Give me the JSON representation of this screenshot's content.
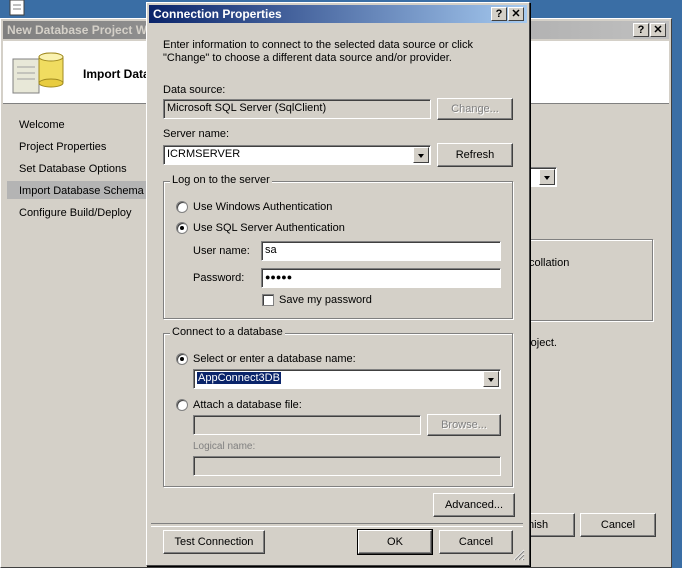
{
  "wizard": {
    "title": "New Database Project W",
    "header_title": "Import Data",
    "nav": [
      {
        "label": "Welcome"
      },
      {
        "label": "Project Properties"
      },
      {
        "label": "Set Database Options"
      },
      {
        "label": "Import Database Schema",
        "selected": true
      },
      {
        "label": "Configure Build/Deploy"
      }
    ],
    "collation_fragment": "collation",
    "project_fragment": "roject.",
    "finish_label": "nish",
    "cancel_label": "Cancel"
  },
  "dialog": {
    "title": "Connection Properties",
    "intro": "Enter information to connect to the selected data source or click \"Change\" to choose a different data source and/or provider.",
    "data_source_label": "Data source:",
    "data_source_value": "Microsoft SQL Server (SqlClient)",
    "change_label": "Change...",
    "server_name_label": "Server name:",
    "server_name_value": "ICRMSERVER",
    "refresh_label": "Refresh",
    "logon_group": "Log on to the server",
    "windows_auth": "Use Windows Authentication",
    "sql_auth": "Use SQL Server Authentication",
    "auth_mode": "sql",
    "user_name_label": "User name:",
    "user_name_value": "sa",
    "password_label": "Password:",
    "password_value": "●●●●●",
    "save_password": "Save my password",
    "connect_group": "Connect to a database",
    "select_db_label": "Select or enter a database name:",
    "db_name_value": "AppConnect3DB",
    "attach_label": "Attach a database file:",
    "browse_label": "Browse...",
    "logical_name_label": "Logical name:",
    "advanced_label": "Advanced...",
    "test_label": "Test Connection",
    "ok_label": "OK",
    "cancel_label": "Cancel",
    "help_glyph": "?",
    "close_glyph": "✕"
  }
}
